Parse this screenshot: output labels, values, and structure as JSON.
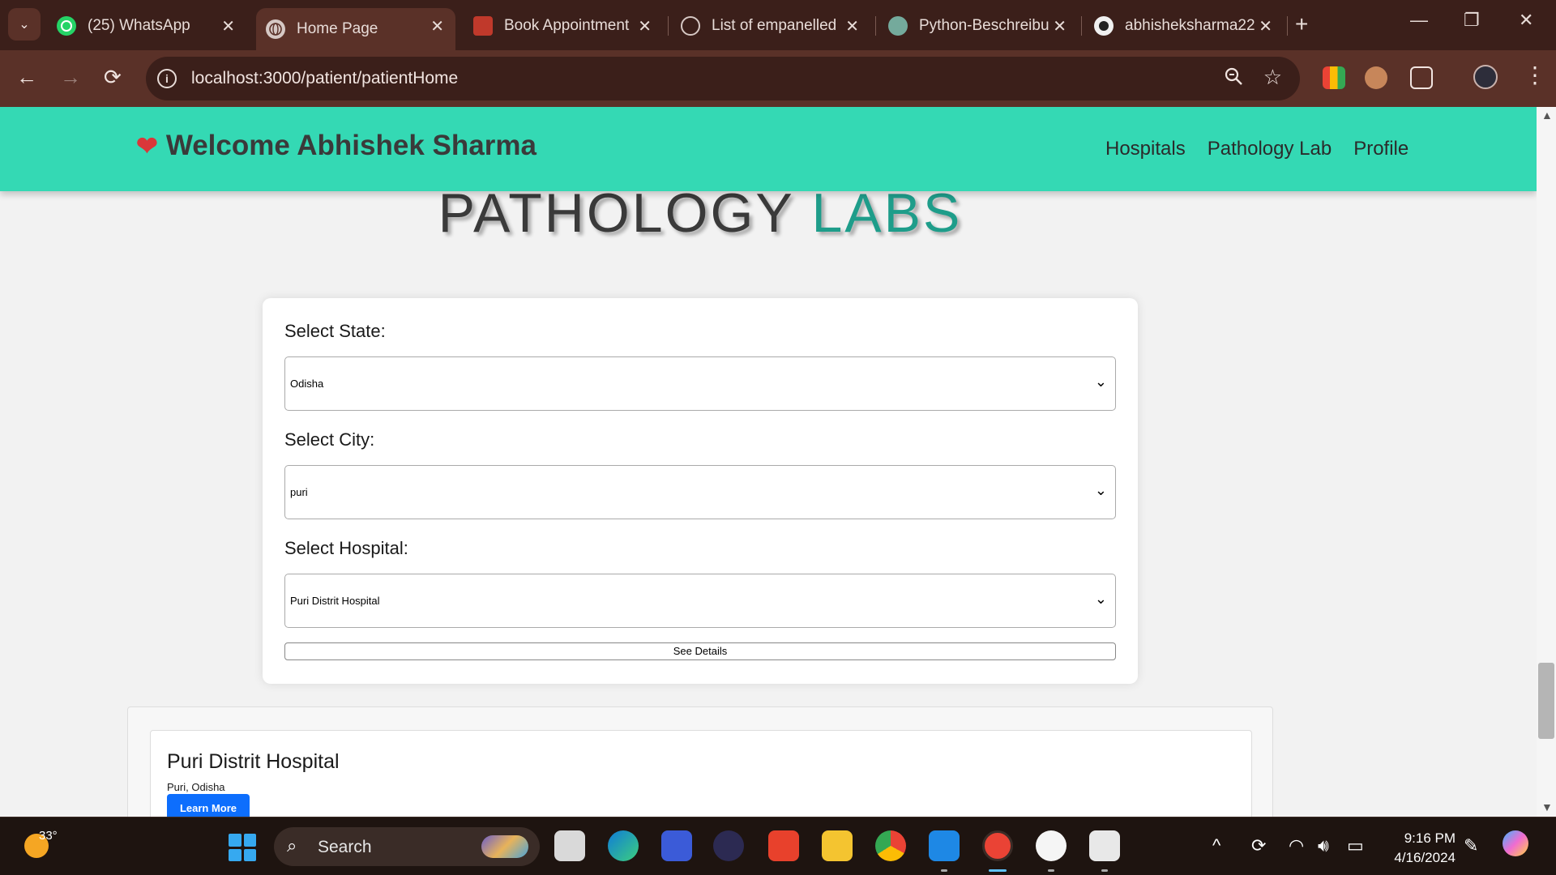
{
  "browser": {
    "tabs": [
      {
        "title": "(25) WhatsApp",
        "icon": "whatsapp-icon"
      },
      {
        "title": "Home Page",
        "icon": "globe-icon",
        "active": true
      },
      {
        "title": "Book Appointment",
        "icon": "book-appointment-icon"
      },
      {
        "title": "List of empanelled",
        "icon": "list-site-icon"
      },
      {
        "title": "Python-Beschreibu",
        "icon": "chatgpt-icon"
      },
      {
        "title": "abhisheksharma22",
        "icon": "github-icon"
      }
    ],
    "url": "localhost:3000/patient/patientHome"
  },
  "navbar": {
    "brand": "Welcome Abhishek Sharma",
    "links": [
      "Hospitals",
      "Pathology Lab",
      "Profile"
    ],
    "color": "#34d9b4"
  },
  "hero": {
    "title_part1": "PATHOLOGY",
    "title_part2": "LABS",
    "accent_color": "#1e9d8a"
  },
  "form": {
    "state_label": "Select State:",
    "state_value": "Odisha",
    "city_label": "Select City:",
    "city_value": "puri",
    "hospital_label": "Select Hospital:",
    "hospital_value": "Puri Distrit Hospital",
    "button_label": "See Details"
  },
  "result": {
    "name": "Puri Distrit Hospital",
    "location": "Puri, Odisha",
    "button_label": "Learn More",
    "button_color": "#0d6efd"
  },
  "taskbar": {
    "weather_temp": "33°",
    "search_placeholder": "Search",
    "time": "9:16 PM",
    "date": "4/16/2024"
  }
}
